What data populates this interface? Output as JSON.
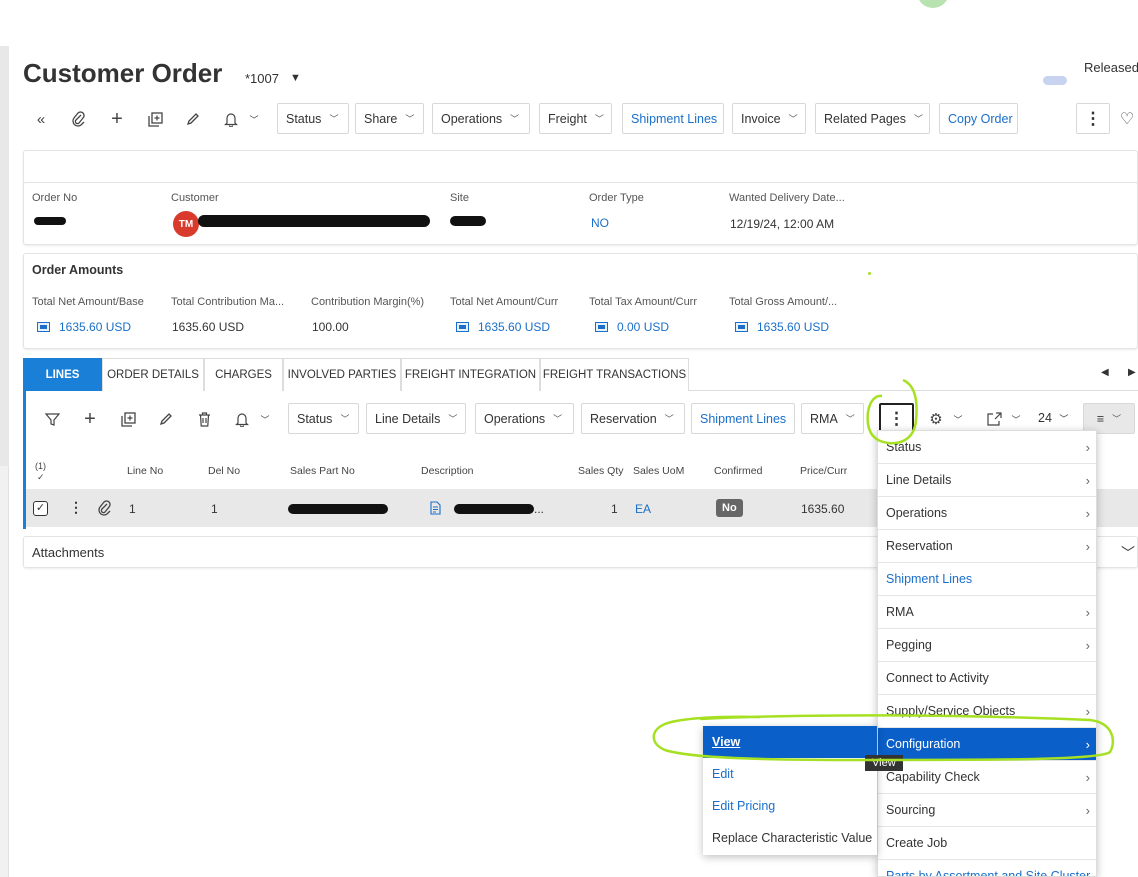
{
  "page": {
    "title": "Customer Order",
    "order_ref": "*1007",
    "status": "Released"
  },
  "toolbar": {
    "status": "Status",
    "share": "Share",
    "operations": "Operations",
    "freight": "Freight",
    "shipment_lines": "Shipment Lines",
    "invoice": "Invoice",
    "related_pages": "Related Pages",
    "copy_order": "Copy Order"
  },
  "header": {
    "order_no_label": "Order No",
    "customer_label": "Customer",
    "customer_initials": "TM",
    "site_label": "Site",
    "order_type_label": "Order Type",
    "order_type_value": "NO",
    "wanted_delivery_label": "Wanted Delivery Date...",
    "wanted_delivery_value": "12/19/24, 12:00 AM"
  },
  "amounts": {
    "title": "Order Amounts",
    "fields": [
      {
        "label": "Total Net Amount/Base",
        "value": "1635.60 USD"
      },
      {
        "label": "Total Contribution Ma...",
        "value": "1635.60 USD"
      },
      {
        "label": "Contribution Margin(%)",
        "value": "100.00"
      },
      {
        "label": "Total Net Amount/Curr",
        "value": "1635.60 USD"
      },
      {
        "label": "Total Tax Amount/Curr",
        "value": "0.00 USD"
      },
      {
        "label": "Total Gross Amount/...",
        "value": "1635.60 USD"
      }
    ]
  },
  "tabs": [
    "LINES",
    "ORDER DETAILS",
    "CHARGES",
    "INVOLVED PARTIES",
    "FREIGHT INTEGRATION",
    "FREIGHT TRANSACTIONS"
  ],
  "lines_toolbar": {
    "status": "Status",
    "line_details": "Line Details",
    "operations": "Operations",
    "reservation": "Reservation",
    "shipment_lines": "Shipment Lines",
    "rma": "RMA",
    "page_size": "24"
  },
  "table": {
    "selected_count": "(1)",
    "columns": [
      "Line No",
      "Del No",
      "Sales Part No",
      "Description",
      "Sales Qty",
      "Sales UoM",
      "Confirmed",
      "Price/Curr"
    ],
    "row": {
      "line_no": "1",
      "del_no": "1",
      "description_suffix": "...",
      "sales_qty": "1",
      "sales_uom": "EA",
      "confirmed": "No",
      "price": "1635.60"
    }
  },
  "attachments": {
    "title": "Attachments"
  },
  "context_menu": {
    "items": [
      {
        "label": "Status",
        "arrow": true
      },
      {
        "label": "Line Details",
        "arrow": true
      },
      {
        "label": "Operations",
        "arrow": true
      },
      {
        "label": "Reservation",
        "arrow": true
      },
      {
        "label": "Shipment Lines",
        "arrow": false
      },
      {
        "label": "RMA",
        "arrow": true
      },
      {
        "label": "Pegging",
        "arrow": true
      },
      {
        "label": "Connect to Activity",
        "arrow": false
      },
      {
        "label": "Supply/Service Objects",
        "arrow": true
      },
      {
        "label": "Configuration",
        "arrow": true
      },
      {
        "label": "Capability Check",
        "arrow": true
      },
      {
        "label": "Sourcing",
        "arrow": true
      },
      {
        "label": "Create Job",
        "arrow": false
      },
      {
        "label": "Parts by Assortment and Site Cluster",
        "arrow": false
      }
    ]
  },
  "submenu": {
    "items": [
      "View",
      "Edit",
      "Edit Pricing",
      "Replace Characteristic Value"
    ]
  },
  "tooltip": "View",
  "colors": {
    "accent": "#1a7fd6",
    "link": "#1a6fc9",
    "selected": "#0b5fc8",
    "highlight": "#a6e022"
  }
}
